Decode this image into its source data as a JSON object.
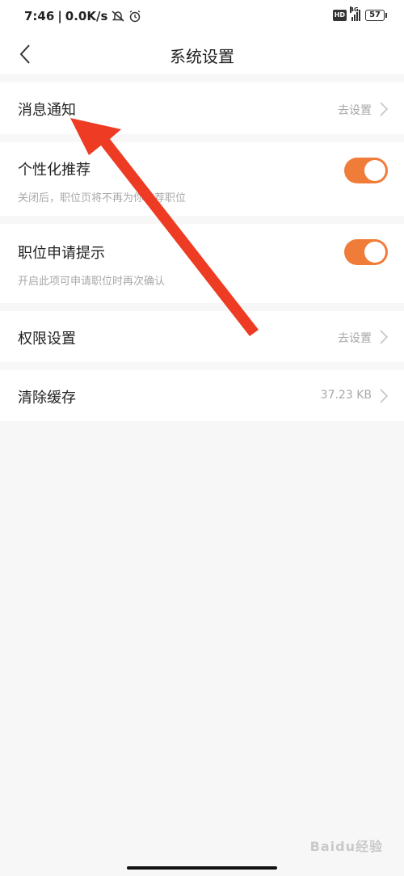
{
  "statusbar": {
    "time": "7:46",
    "speed": "0.0K/s",
    "hd": "HD",
    "network": "4G",
    "battery": "57"
  },
  "header": {
    "title": "系统设置"
  },
  "settings": {
    "notifications": {
      "label": "消息通知",
      "action": "去设置"
    },
    "personalized": {
      "label": "个性化推荐",
      "description": "关闭后，职位页将不再为你推荐职位",
      "enabled": true
    },
    "apply_prompt": {
      "label": "职位申请提示",
      "description": "开启此项可申请职位时再次确认",
      "enabled": true
    },
    "permissions": {
      "label": "权限设置",
      "action": "去设置"
    },
    "cache": {
      "label": "清除缓存",
      "value": "37.23 KB"
    }
  },
  "watermark": "Baidu经验",
  "colors": {
    "accent": "#f07c3a",
    "annotation_arrow": "#ee3b24"
  }
}
